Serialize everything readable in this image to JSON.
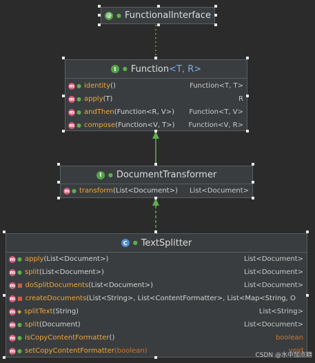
{
  "functional_interface": {
    "title": "FunctionalInterface",
    "icon": "annotation-icon"
  },
  "function_box": {
    "title_name": "Function",
    "title_params": "<T, R>",
    "icon": "interface-icon",
    "methods": [
      {
        "name": "identity",
        "params": "()",
        "ret": "Function<T, T>",
        "visibility": "public"
      },
      {
        "name": "apply",
        "params": "(T)",
        "ret": "R",
        "visibility": "public"
      },
      {
        "name": "andThen",
        "params": "(Function<R, V>)",
        "ret": "Function<T, V>",
        "visibility": "public"
      },
      {
        "name": "compose",
        "params": "(Function<V, T>)",
        "ret": "Function<V, R>",
        "visibility": "public"
      }
    ]
  },
  "document_transformer": {
    "title": "DocumentTransformer",
    "icon": "interface-icon",
    "methods": [
      {
        "name": "transform",
        "params": "(List<Document>)",
        "ret": "List<Document>",
        "visibility": "public"
      }
    ]
  },
  "text_splitter": {
    "title": "TextSplitter",
    "icon": "abstract-class-icon",
    "methods": [
      {
        "name": "apply",
        "params": "(List<Document>)",
        "ret": "List<Document>",
        "visibility": "public"
      },
      {
        "name": "split",
        "params": "(List<Document>)",
        "ret": "List<Document>",
        "visibility": "public"
      },
      {
        "name": "doSplitDocuments",
        "params": "(List<Document>)",
        "ret": "List<Document>",
        "visibility": "private"
      },
      {
        "name": "createDocuments",
        "params": "(List<String>, List<ContentFormatter>, List<Map<String, O",
        "ret": "",
        "visibility": "private"
      },
      {
        "name": "splitText",
        "params": "(String)",
        "ret": "List<String>",
        "visibility": "protected"
      },
      {
        "name": "split",
        "params": "(Document)",
        "ret": "List<Document>",
        "visibility": "public"
      },
      {
        "name": "isCopyContentFormatter",
        "params": "()",
        "ret": "boolean",
        "visibility": "public"
      },
      {
        "name": "setCopyContentFormatter",
        "params": "(boolean)",
        "ret": "void",
        "visibility": "public"
      }
    ]
  },
  "watermark": "CSDN @水中加点糖",
  "colors": {
    "background": "#2b2b2b",
    "box": "#3a3d3f",
    "method_name": "#f0a73a",
    "type_param": "#7fb0e0",
    "keyword": "#cc7832",
    "arrow": "#5fae4d"
  }
}
